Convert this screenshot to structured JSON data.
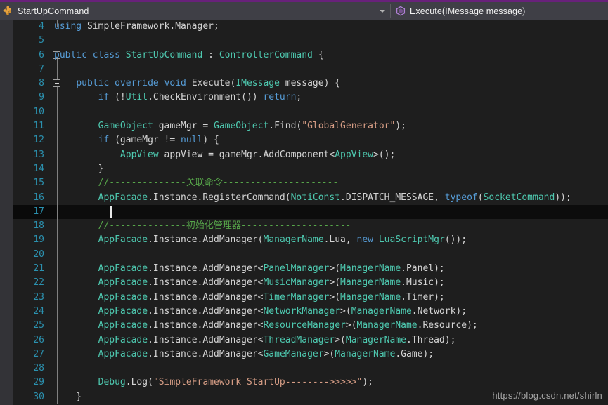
{
  "window": {
    "accent_color": "#68217a",
    "navbar_bg": "#3f3f46",
    "editor_bg": "#1e1e1e"
  },
  "navbar": {
    "type_selector": {
      "label": "StartUpCommand",
      "icon": "class-icon",
      "icon_color": "#e8a33d"
    },
    "member_selector": {
      "label": "Execute(IMessage message)",
      "icon": "method-icon",
      "icon_color": "#b180d7"
    },
    "caret_icon": "chevron-down-icon"
  },
  "editor": {
    "language": "csharp",
    "cursor_line": 17,
    "first_visible_line": 4,
    "last_visible_line": 30,
    "lines": [
      {
        "n": "4",
        "fold": "elbow",
        "tokens": [
          {
            "t": "using ",
            "c": "k"
          },
          {
            "t": "SimpleFramework",
            "c": "p"
          },
          {
            "t": ".",
            "c": "p"
          },
          {
            "t": "Manager",
            "c": "p"
          },
          {
            "t": ";",
            "c": "p"
          }
        ]
      },
      {
        "n": "5",
        "fold": "none",
        "tokens": []
      },
      {
        "n": "6",
        "fold": "box",
        "tokens": [
          {
            "t": "public ",
            "c": "k"
          },
          {
            "t": "class ",
            "c": "k"
          },
          {
            "t": "StartUpCommand",
            "c": "t"
          },
          {
            "t": " : ",
            "c": "p"
          },
          {
            "t": "ControllerCommand",
            "c": "t"
          },
          {
            "t": " {",
            "c": "p"
          }
        ]
      },
      {
        "n": "7",
        "fold": "line",
        "tokens": []
      },
      {
        "n": "8",
        "fold": "box-line",
        "tokens": [
          {
            "t": "    ",
            "c": "p"
          },
          {
            "t": "public ",
            "c": "k"
          },
          {
            "t": "override ",
            "c": "k"
          },
          {
            "t": "void ",
            "c": "k"
          },
          {
            "t": "Execute",
            "c": "p"
          },
          {
            "t": "(",
            "c": "p"
          },
          {
            "t": "IMessage",
            "c": "t"
          },
          {
            "t": " message",
            "c": "p"
          },
          {
            "t": ") {",
            "c": "p"
          }
        ]
      },
      {
        "n": "9",
        "fold": "line",
        "tokens": [
          {
            "t": "        ",
            "c": "p"
          },
          {
            "t": "if ",
            "c": "k"
          },
          {
            "t": "(!",
            "c": "p"
          },
          {
            "t": "Util",
            "c": "t"
          },
          {
            "t": ".",
            "c": "p"
          },
          {
            "t": "CheckEnvironment",
            "c": "p"
          },
          {
            "t": "()) ",
            "c": "p"
          },
          {
            "t": "return",
            "c": "k"
          },
          {
            "t": ";",
            "c": "p"
          }
        ]
      },
      {
        "n": "10",
        "fold": "line",
        "tokens": []
      },
      {
        "n": "11",
        "fold": "line",
        "tokens": [
          {
            "t": "        ",
            "c": "p"
          },
          {
            "t": "GameObject",
            "c": "t"
          },
          {
            "t": " gameMgr = ",
            "c": "p"
          },
          {
            "t": "GameObject",
            "c": "t"
          },
          {
            "t": ".",
            "c": "p"
          },
          {
            "t": "Find",
            "c": "p"
          },
          {
            "t": "(",
            "c": "p"
          },
          {
            "t": "\"GlobalGenerator\"",
            "c": "s"
          },
          {
            "t": ");",
            "c": "p"
          }
        ]
      },
      {
        "n": "12",
        "fold": "line",
        "tokens": [
          {
            "t": "        ",
            "c": "p"
          },
          {
            "t": "if ",
            "c": "k"
          },
          {
            "t": "(gameMgr != ",
            "c": "p"
          },
          {
            "t": "null",
            "c": "k"
          },
          {
            "t": ") {",
            "c": "p"
          }
        ]
      },
      {
        "n": "13",
        "fold": "line",
        "tokens": [
          {
            "t": "            ",
            "c": "p"
          },
          {
            "t": "AppView",
            "c": "t"
          },
          {
            "t": " appView = gameMgr.",
            "c": "p"
          },
          {
            "t": "AddComponent",
            "c": "p"
          },
          {
            "t": "<",
            "c": "p"
          },
          {
            "t": "AppView",
            "c": "t"
          },
          {
            "t": ">();",
            "c": "p"
          }
        ]
      },
      {
        "n": "14",
        "fold": "line",
        "tokens": [
          {
            "t": "        }",
            "c": "p"
          }
        ]
      },
      {
        "n": "15",
        "fold": "line",
        "tokens": [
          {
            "t": "        //--------------关联命令---------------------",
            "c": "c"
          }
        ]
      },
      {
        "n": "16",
        "fold": "line",
        "tokens": [
          {
            "t": "        ",
            "c": "p"
          },
          {
            "t": "AppFacade",
            "c": "t"
          },
          {
            "t": ".",
            "c": "p"
          },
          {
            "t": "Instance",
            "c": "p"
          },
          {
            "t": ".",
            "c": "p"
          },
          {
            "t": "RegisterCommand",
            "c": "p"
          },
          {
            "t": "(",
            "c": "p"
          },
          {
            "t": "NotiConst",
            "c": "t"
          },
          {
            "t": ".DISPATCH_MESSAGE, ",
            "c": "p"
          },
          {
            "t": "typeof",
            "c": "k"
          },
          {
            "t": "(",
            "c": "p"
          },
          {
            "t": "SocketCommand",
            "c": "t"
          },
          {
            "t": "));",
            "c": "p"
          }
        ]
      },
      {
        "n": "17",
        "fold": "line",
        "current": true,
        "tokens": []
      },
      {
        "n": "18",
        "fold": "line",
        "tokens": [
          {
            "t": "        //--------------初始化管理器--------------------",
            "c": "c"
          }
        ]
      },
      {
        "n": "19",
        "fold": "line",
        "tokens": [
          {
            "t": "        ",
            "c": "p"
          },
          {
            "t": "AppFacade",
            "c": "t"
          },
          {
            "t": ".",
            "c": "p"
          },
          {
            "t": "Instance",
            "c": "p"
          },
          {
            "t": ".",
            "c": "p"
          },
          {
            "t": "AddManager",
            "c": "p"
          },
          {
            "t": "(",
            "c": "p"
          },
          {
            "t": "ManagerName",
            "c": "t"
          },
          {
            "t": ".Lua, ",
            "c": "p"
          },
          {
            "t": "new ",
            "c": "k"
          },
          {
            "t": "LuaScriptMgr",
            "c": "t"
          },
          {
            "t": "());",
            "c": "p"
          }
        ]
      },
      {
        "n": "20",
        "fold": "line",
        "tokens": []
      },
      {
        "n": "21",
        "fold": "line",
        "tokens": [
          {
            "t": "        ",
            "c": "p"
          },
          {
            "t": "AppFacade",
            "c": "t"
          },
          {
            "t": ".",
            "c": "p"
          },
          {
            "t": "Instance",
            "c": "p"
          },
          {
            "t": ".",
            "c": "p"
          },
          {
            "t": "AddManager",
            "c": "p"
          },
          {
            "t": "<",
            "c": "p"
          },
          {
            "t": "PanelManager",
            "c": "t"
          },
          {
            "t": ">(",
            "c": "p"
          },
          {
            "t": "ManagerName",
            "c": "t"
          },
          {
            "t": ".Panel);",
            "c": "p"
          }
        ]
      },
      {
        "n": "22",
        "fold": "line",
        "tokens": [
          {
            "t": "        ",
            "c": "p"
          },
          {
            "t": "AppFacade",
            "c": "t"
          },
          {
            "t": ".",
            "c": "p"
          },
          {
            "t": "Instance",
            "c": "p"
          },
          {
            "t": ".",
            "c": "p"
          },
          {
            "t": "AddManager",
            "c": "p"
          },
          {
            "t": "<",
            "c": "p"
          },
          {
            "t": "MusicManager",
            "c": "t"
          },
          {
            "t": ">(",
            "c": "p"
          },
          {
            "t": "ManagerName",
            "c": "t"
          },
          {
            "t": ".Music);",
            "c": "p"
          }
        ]
      },
      {
        "n": "23",
        "fold": "line",
        "tokens": [
          {
            "t": "        ",
            "c": "p"
          },
          {
            "t": "AppFacade",
            "c": "t"
          },
          {
            "t": ".",
            "c": "p"
          },
          {
            "t": "Instance",
            "c": "p"
          },
          {
            "t": ".",
            "c": "p"
          },
          {
            "t": "AddManager",
            "c": "p"
          },
          {
            "t": "<",
            "c": "p"
          },
          {
            "t": "TimerManager",
            "c": "t"
          },
          {
            "t": ">(",
            "c": "p"
          },
          {
            "t": "ManagerName",
            "c": "t"
          },
          {
            "t": ".Timer);",
            "c": "p"
          }
        ]
      },
      {
        "n": "24",
        "fold": "line",
        "tokens": [
          {
            "t": "        ",
            "c": "p"
          },
          {
            "t": "AppFacade",
            "c": "t"
          },
          {
            "t": ".",
            "c": "p"
          },
          {
            "t": "Instance",
            "c": "p"
          },
          {
            "t": ".",
            "c": "p"
          },
          {
            "t": "AddManager",
            "c": "p"
          },
          {
            "t": "<",
            "c": "p"
          },
          {
            "t": "NetworkManager",
            "c": "t"
          },
          {
            "t": ">(",
            "c": "p"
          },
          {
            "t": "ManagerName",
            "c": "t"
          },
          {
            "t": ".Network);",
            "c": "p"
          }
        ]
      },
      {
        "n": "25",
        "fold": "line",
        "tokens": [
          {
            "t": "        ",
            "c": "p"
          },
          {
            "t": "AppFacade",
            "c": "t"
          },
          {
            "t": ".",
            "c": "p"
          },
          {
            "t": "Instance",
            "c": "p"
          },
          {
            "t": ".",
            "c": "p"
          },
          {
            "t": "AddManager",
            "c": "p"
          },
          {
            "t": "<",
            "c": "p"
          },
          {
            "t": "ResourceManager",
            "c": "t"
          },
          {
            "t": ">(",
            "c": "p"
          },
          {
            "t": "ManagerName",
            "c": "t"
          },
          {
            "t": ".Resource);",
            "c": "p"
          }
        ]
      },
      {
        "n": "26",
        "fold": "line",
        "tokens": [
          {
            "t": "        ",
            "c": "p"
          },
          {
            "t": "AppFacade",
            "c": "t"
          },
          {
            "t": ".",
            "c": "p"
          },
          {
            "t": "Instance",
            "c": "p"
          },
          {
            "t": ".",
            "c": "p"
          },
          {
            "t": "AddManager",
            "c": "p"
          },
          {
            "t": "<",
            "c": "p"
          },
          {
            "t": "ThreadManager",
            "c": "t"
          },
          {
            "t": ">(",
            "c": "p"
          },
          {
            "t": "ManagerName",
            "c": "t"
          },
          {
            "t": ".Thread);",
            "c": "p"
          }
        ]
      },
      {
        "n": "27",
        "fold": "line",
        "tokens": [
          {
            "t": "        ",
            "c": "p"
          },
          {
            "t": "AppFacade",
            "c": "t"
          },
          {
            "t": ".",
            "c": "p"
          },
          {
            "t": "Instance",
            "c": "p"
          },
          {
            "t": ".",
            "c": "p"
          },
          {
            "t": "AddManager",
            "c": "p"
          },
          {
            "t": "<",
            "c": "p"
          },
          {
            "t": "GameManager",
            "c": "t"
          },
          {
            "t": ">(",
            "c": "p"
          },
          {
            "t": "ManagerName",
            "c": "t"
          },
          {
            "t": ".Game);",
            "c": "p"
          }
        ]
      },
      {
        "n": "28",
        "fold": "line",
        "tokens": []
      },
      {
        "n": "29",
        "fold": "line",
        "tokens": [
          {
            "t": "        ",
            "c": "p"
          },
          {
            "t": "Debug",
            "c": "t"
          },
          {
            "t": ".",
            "c": "p"
          },
          {
            "t": "Log",
            "c": "p"
          },
          {
            "t": "(",
            "c": "p"
          },
          {
            "t": "\"SimpleFramework StartUp-------->>>>>\"",
            "c": "s"
          },
          {
            "t": ");",
            "c": "p"
          }
        ]
      },
      {
        "n": "30",
        "fold": "line",
        "tokens": [
          {
            "t": "    }",
            "c": "p"
          }
        ]
      }
    ]
  },
  "watermark": {
    "text": "https://blog.csdn.net/shirln"
  }
}
